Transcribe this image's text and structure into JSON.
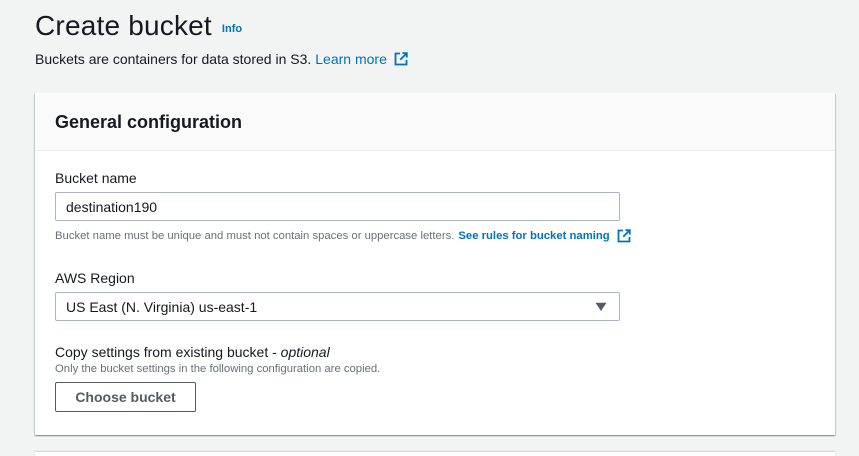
{
  "header": {
    "title": "Create bucket",
    "info_label": "Info",
    "description": "Buckets are containers for data stored in S3.",
    "learn_more_label": "Learn more"
  },
  "general_configuration": {
    "title": "General configuration",
    "bucket_name": {
      "label": "Bucket name",
      "value": "destination190",
      "hint": "Bucket name must be unique and must not contain spaces or uppercase letters.",
      "hint_link": "See rules for bucket naming"
    },
    "aws_region": {
      "label": "AWS Region",
      "selected": "US East (N. Virginia) us-east-1"
    },
    "copy_settings": {
      "label": "Copy settings from existing bucket - ",
      "label_optional": "optional",
      "description": "Only the bucket settings in the following configuration are copied.",
      "button_label": "Choose bucket"
    }
  },
  "colors": {
    "link": "#0073bb",
    "background": "#f2f3f3",
    "panel": "#ffffff",
    "text": "#16191f",
    "secondary_text": "#687078"
  },
  "icons": [
    "external-link-icon",
    "caret-down-icon"
  ]
}
